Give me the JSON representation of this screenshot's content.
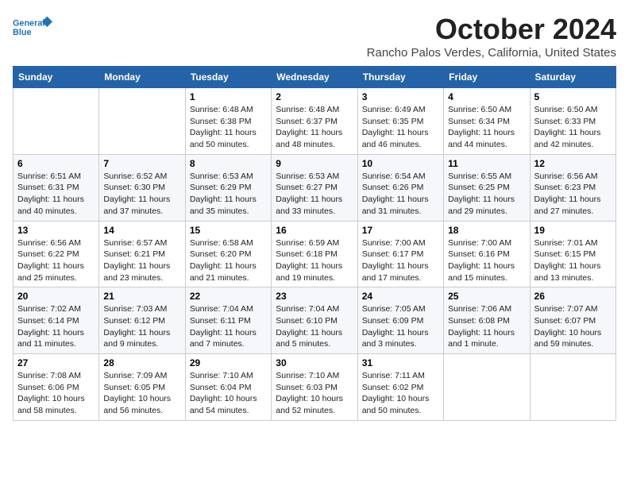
{
  "header": {
    "logo_line1": "General",
    "logo_line2": "Blue",
    "month": "October 2024",
    "location": "Rancho Palos Verdes, California, United States"
  },
  "days_of_week": [
    "Sunday",
    "Monday",
    "Tuesday",
    "Wednesday",
    "Thursday",
    "Friday",
    "Saturday"
  ],
  "weeks": [
    [
      {
        "day": null
      },
      {
        "day": null
      },
      {
        "day": "1",
        "sunrise": "6:48 AM",
        "sunset": "6:38 PM",
        "daylight": "11 hours and 50 minutes."
      },
      {
        "day": "2",
        "sunrise": "6:48 AM",
        "sunset": "6:37 PM",
        "daylight": "11 hours and 48 minutes."
      },
      {
        "day": "3",
        "sunrise": "6:49 AM",
        "sunset": "6:35 PM",
        "daylight": "11 hours and 46 minutes."
      },
      {
        "day": "4",
        "sunrise": "6:50 AM",
        "sunset": "6:34 PM",
        "daylight": "11 hours and 44 minutes."
      },
      {
        "day": "5",
        "sunrise": "6:50 AM",
        "sunset": "6:33 PM",
        "daylight": "11 hours and 42 minutes."
      }
    ],
    [
      {
        "day": "6",
        "sunrise": "6:51 AM",
        "sunset": "6:31 PM",
        "daylight": "11 hours and 40 minutes."
      },
      {
        "day": "7",
        "sunrise": "6:52 AM",
        "sunset": "6:30 PM",
        "daylight": "11 hours and 37 minutes."
      },
      {
        "day": "8",
        "sunrise": "6:53 AM",
        "sunset": "6:29 PM",
        "daylight": "11 hours and 35 minutes."
      },
      {
        "day": "9",
        "sunrise": "6:53 AM",
        "sunset": "6:27 PM",
        "daylight": "11 hours and 33 minutes."
      },
      {
        "day": "10",
        "sunrise": "6:54 AM",
        "sunset": "6:26 PM",
        "daylight": "11 hours and 31 minutes."
      },
      {
        "day": "11",
        "sunrise": "6:55 AM",
        "sunset": "6:25 PM",
        "daylight": "11 hours and 29 minutes."
      },
      {
        "day": "12",
        "sunrise": "6:56 AM",
        "sunset": "6:23 PM",
        "daylight": "11 hours and 27 minutes."
      }
    ],
    [
      {
        "day": "13",
        "sunrise": "6:56 AM",
        "sunset": "6:22 PM",
        "daylight": "11 hours and 25 minutes."
      },
      {
        "day": "14",
        "sunrise": "6:57 AM",
        "sunset": "6:21 PM",
        "daylight": "11 hours and 23 minutes."
      },
      {
        "day": "15",
        "sunrise": "6:58 AM",
        "sunset": "6:20 PM",
        "daylight": "11 hours and 21 minutes."
      },
      {
        "day": "16",
        "sunrise": "6:59 AM",
        "sunset": "6:18 PM",
        "daylight": "11 hours and 19 minutes."
      },
      {
        "day": "17",
        "sunrise": "7:00 AM",
        "sunset": "6:17 PM",
        "daylight": "11 hours and 17 minutes."
      },
      {
        "day": "18",
        "sunrise": "7:00 AM",
        "sunset": "6:16 PM",
        "daylight": "11 hours and 15 minutes."
      },
      {
        "day": "19",
        "sunrise": "7:01 AM",
        "sunset": "6:15 PM",
        "daylight": "11 hours and 13 minutes."
      }
    ],
    [
      {
        "day": "20",
        "sunrise": "7:02 AM",
        "sunset": "6:14 PM",
        "daylight": "11 hours and 11 minutes."
      },
      {
        "day": "21",
        "sunrise": "7:03 AM",
        "sunset": "6:12 PM",
        "daylight": "11 hours and 9 minutes."
      },
      {
        "day": "22",
        "sunrise": "7:04 AM",
        "sunset": "6:11 PM",
        "daylight": "11 hours and 7 minutes."
      },
      {
        "day": "23",
        "sunrise": "7:04 AM",
        "sunset": "6:10 PM",
        "daylight": "11 hours and 5 minutes."
      },
      {
        "day": "24",
        "sunrise": "7:05 AM",
        "sunset": "6:09 PM",
        "daylight": "11 hours and 3 minutes."
      },
      {
        "day": "25",
        "sunrise": "7:06 AM",
        "sunset": "6:08 PM",
        "daylight": "11 hours and 1 minute."
      },
      {
        "day": "26",
        "sunrise": "7:07 AM",
        "sunset": "6:07 PM",
        "daylight": "10 hours and 59 minutes."
      }
    ],
    [
      {
        "day": "27",
        "sunrise": "7:08 AM",
        "sunset": "6:06 PM",
        "daylight": "10 hours and 58 minutes."
      },
      {
        "day": "28",
        "sunrise": "7:09 AM",
        "sunset": "6:05 PM",
        "daylight": "10 hours and 56 minutes."
      },
      {
        "day": "29",
        "sunrise": "7:10 AM",
        "sunset": "6:04 PM",
        "daylight": "10 hours and 54 minutes."
      },
      {
        "day": "30",
        "sunrise": "7:10 AM",
        "sunset": "6:03 PM",
        "daylight": "10 hours and 52 minutes."
      },
      {
        "day": "31",
        "sunrise": "7:11 AM",
        "sunset": "6:02 PM",
        "daylight": "10 hours and 50 minutes."
      },
      {
        "day": null
      },
      {
        "day": null
      }
    ]
  ]
}
